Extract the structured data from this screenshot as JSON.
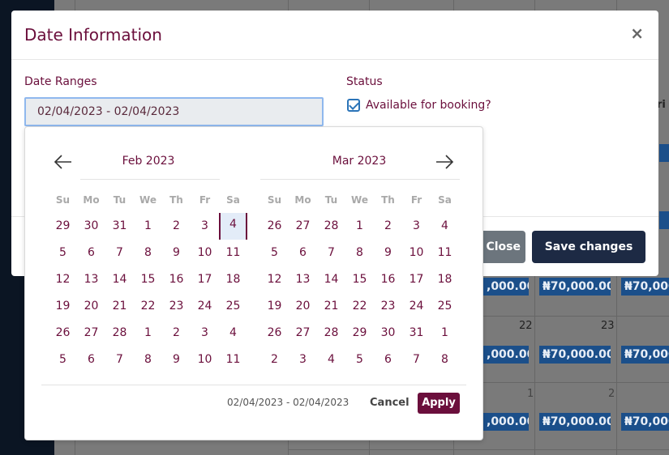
{
  "modal": {
    "title": "Date Information",
    "close_glyph": "×",
    "date_ranges_label": "Date Ranges",
    "date_range_value": "02/04/2023 - 02/04/2023",
    "status_label": "Status",
    "available_label": "Available for booking?",
    "available_checked": true,
    "close_button": "Close",
    "save_button": "Save changes"
  },
  "datepicker": {
    "prev_icon": "arrow-left-icon",
    "next_icon": "arrow-right-icon",
    "weekdays": [
      "Su",
      "Mo",
      "Tu",
      "We",
      "Th",
      "Fr",
      "Sa"
    ],
    "left_month": {
      "title": "Feb 2023",
      "weeks": [
        [
          "29",
          "30",
          "31",
          "1",
          "2",
          "3",
          "4"
        ],
        [
          "5",
          "6",
          "7",
          "8",
          "9",
          "10",
          "11"
        ],
        [
          "12",
          "13",
          "14",
          "15",
          "16",
          "17",
          "18"
        ],
        [
          "19",
          "20",
          "21",
          "22",
          "23",
          "24",
          "25"
        ],
        [
          "26",
          "27",
          "28",
          "1",
          "2",
          "3",
          "4"
        ],
        [
          "5",
          "6",
          "7",
          "8",
          "9",
          "10",
          "11"
        ]
      ],
      "selected": "4"
    },
    "right_month": {
      "title": "Mar 2023",
      "weeks": [
        [
          "26",
          "27",
          "28",
          "1",
          "2",
          "3",
          "4"
        ],
        [
          "5",
          "6",
          "7",
          "8",
          "9",
          "10",
          "11"
        ],
        [
          "12",
          "13",
          "14",
          "15",
          "16",
          "17",
          "18"
        ],
        [
          "19",
          "20",
          "21",
          "22",
          "23",
          "24",
          "25"
        ],
        [
          "26",
          "27",
          "28",
          "29",
          "30",
          "31",
          "1"
        ],
        [
          "2",
          "3",
          "4",
          "5",
          "6",
          "7",
          "8"
        ]
      ]
    },
    "selected_range": "02/04/2023 - 02/04/2023",
    "cancel_label": "Cancel",
    "apply_label": "Apply"
  },
  "background": {
    "price_label": "₦70,000.00",
    "partial_price_label": ",000.00",
    "fri_header": "ri",
    "day_numbers": [
      "22",
      "23",
      "1",
      "2"
    ]
  },
  "colors": {
    "accent": "#6b0f3c",
    "save_button": "#1d2a44",
    "close_button": "#6c757d",
    "price_pill": "#1b4f8a",
    "selected_day_bg": "#e3ecf8"
  }
}
